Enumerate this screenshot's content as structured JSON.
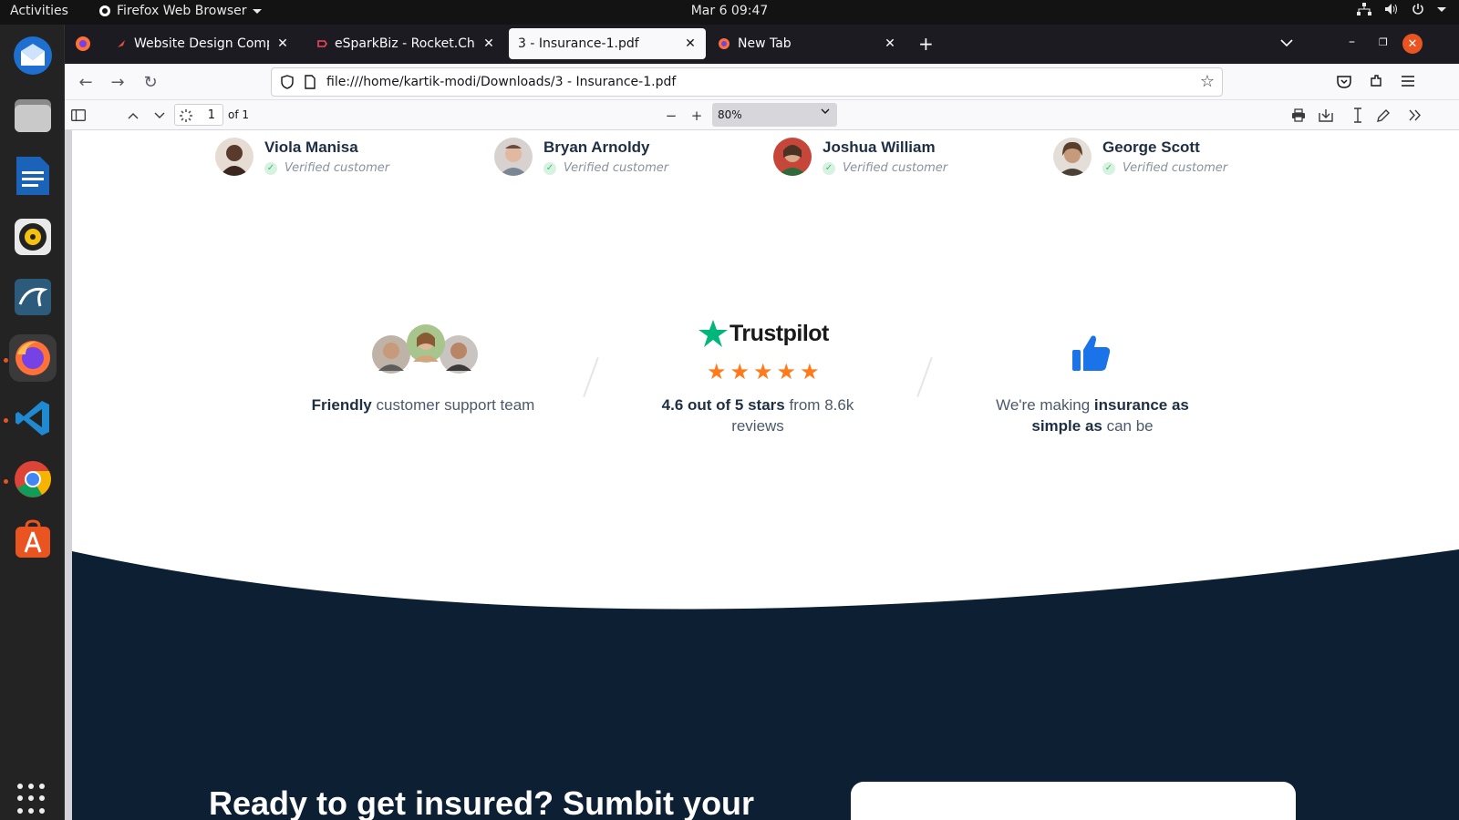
{
  "topbar": {
    "activities": "Activities",
    "app_name": "Firefox Web Browser",
    "datetime": "Mar 6  09:47"
  },
  "dock": {
    "items": [
      "thunderbird-icon",
      "files-icon",
      "writer-icon",
      "rhythmbox-icon",
      "mysql-workbench-icon",
      "firefox-icon",
      "vscode-icon",
      "chrome-icon",
      "software-center-icon"
    ]
  },
  "tabs": [
    {
      "label": "Website Design Company",
      "selected": false
    },
    {
      "label": "eSparkBiz - Rocket.Chat",
      "selected": false
    },
    {
      "label": "3 - Insurance-1.pdf",
      "selected": true
    },
    {
      "label": "New Tab",
      "selected": false
    }
  ],
  "url": "file:///home/kartik-modi/Downloads/3 - Insurance-1.pdf",
  "pdf_toolbar": {
    "page": "1",
    "page_count": "of 1",
    "zoom": "80%"
  },
  "customers": [
    {
      "name": "Viola Manisa",
      "badge": "Verified customer"
    },
    {
      "name": "Bryan Arnoldy",
      "badge": "Verified customer"
    },
    {
      "name": "Joshua William",
      "badge": "Verified customer"
    },
    {
      "name": "George Scott",
      "badge": "Verified customer"
    }
  ],
  "features": {
    "support": {
      "bold": "Friendly",
      "rest": " customer support team"
    },
    "trustpilot": {
      "brand": "Trustpilot",
      "rating": 5,
      "bold": "4.6 out of 5 stars",
      "rest": " from 8.6k reviews"
    },
    "simple": {
      "lead": "We're making ",
      "bold": "insurance as simple as",
      "rest": " can be"
    }
  },
  "cta_title": "Ready to get insured? Sumbit your",
  "colors": {
    "navy": "#0d1f33",
    "trustpilot_green": "#00b67a",
    "star_orange": "#ff7a1a",
    "thumb_blue": "#1a73e8"
  }
}
